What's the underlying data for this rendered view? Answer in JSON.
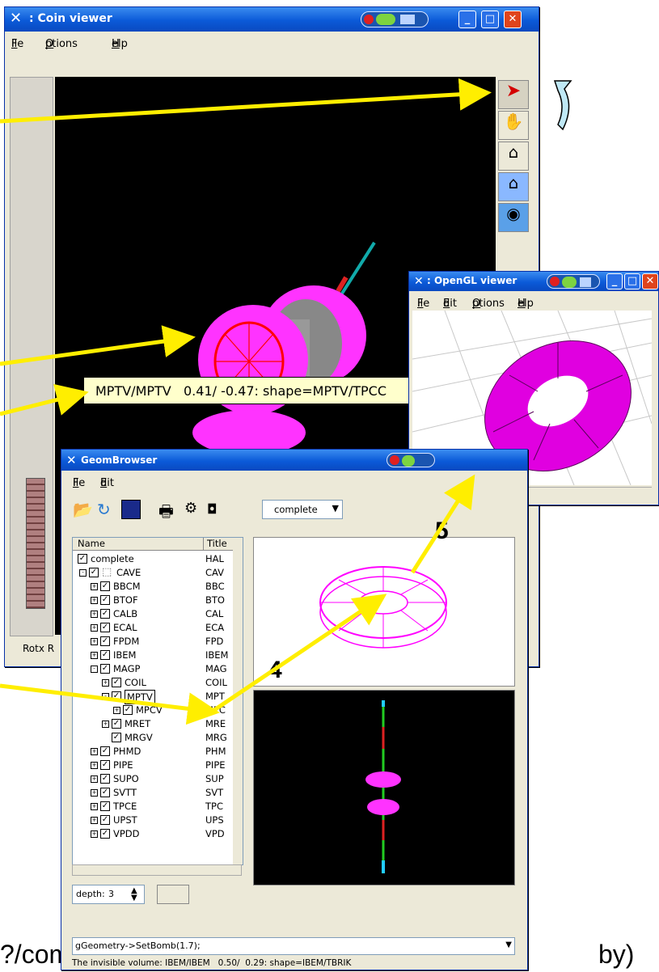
{
  "coin_viewer": {
    "title": "Coin viewer",
    "menu": [
      "File",
      "Options",
      "Help"
    ],
    "side_label": "Rotx R",
    "tooltip": "MPTV/MPTV   0.41/ -0.47: shape=MPTV/TPCC"
  },
  "opengl_viewer": {
    "title": "OpenGL viewer",
    "menu": [
      "File",
      "Edit",
      "Options",
      "Help"
    ]
  },
  "geom_browser": {
    "title": "GeomBrowser",
    "menu": [
      "File",
      "Edit"
    ],
    "combo_value": "complete",
    "columns": [
      "Name",
      "Title"
    ],
    "tree": [
      {
        "name": "complete",
        "title": "HAL",
        "indent": 0,
        "exp": "",
        "sel": false
      },
      {
        "name": "CAVE",
        "title": "CAV",
        "indent": 1,
        "exp": "-",
        "sel": false,
        "icon": true
      },
      {
        "name": "BBCM",
        "title": "BBC",
        "indent": 2,
        "exp": "+",
        "sel": false
      },
      {
        "name": "BTOF",
        "title": "BTO",
        "indent": 2,
        "exp": "+",
        "sel": false
      },
      {
        "name": "CALB",
        "title": "CAL",
        "indent": 2,
        "exp": "+",
        "sel": false
      },
      {
        "name": "ECAL",
        "title": "ECA",
        "indent": 2,
        "exp": "+",
        "sel": false
      },
      {
        "name": "FPDM",
        "title": "FPD",
        "indent": 2,
        "exp": "+",
        "sel": false
      },
      {
        "name": "IBEM",
        "title": "IBEM",
        "indent": 2,
        "exp": "+",
        "sel": false
      },
      {
        "name": "MAGP",
        "title": "MAG",
        "indent": 2,
        "exp": "-",
        "sel": false
      },
      {
        "name": "COIL",
        "title": "COIL",
        "indent": 3,
        "exp": "+",
        "sel": false
      },
      {
        "name": "MPTV",
        "title": "MPT",
        "indent": 3,
        "exp": "-",
        "sel": true
      },
      {
        "name": "MPCV",
        "title": "MPC",
        "indent": 4,
        "exp": "+",
        "sel": false
      },
      {
        "name": "MRET",
        "title": "MRE",
        "indent": 3,
        "exp": "+",
        "sel": false
      },
      {
        "name": "MRGV",
        "title": "MRG",
        "indent": 3,
        "exp": "",
        "sel": false
      },
      {
        "name": "PHMD",
        "title": "PHM",
        "indent": 2,
        "exp": "+",
        "sel": false
      },
      {
        "name": "PIPE",
        "title": "PIPE",
        "indent": 2,
        "exp": "+",
        "sel": false
      },
      {
        "name": "SUPO",
        "title": "SUP",
        "indent": 2,
        "exp": "+",
        "sel": false
      },
      {
        "name": "SVTT",
        "title": "SVT",
        "indent": 2,
        "exp": "+",
        "sel": false
      },
      {
        "name": "TPCE",
        "title": "TPC",
        "indent": 2,
        "exp": "+",
        "sel": false
      },
      {
        "name": "UPST",
        "title": "UPS",
        "indent": 2,
        "exp": "+",
        "sel": false
      },
      {
        "name": "VPDD",
        "title": "VPD",
        "indent": 2,
        "exp": "+",
        "sel": false
      }
    ],
    "depth_label": "depth:",
    "depth_value": "3",
    "command": "gGeometry->SetBomb(1.7);",
    "status": "The invisible volume: IBEM/IBEM   0.50/  0.29: shape=IBEM/TBRIK"
  },
  "callouts": {
    "four": "4",
    "five": "5"
  },
  "slide_text": {
    "left": "?/com",
    "right": "by)"
  },
  "colors": {
    "accent_yellow": "#ffee00",
    "magenta": "#ff00ff",
    "xp_blue": "#0b5ad8",
    "close_red": "#e0441c"
  }
}
